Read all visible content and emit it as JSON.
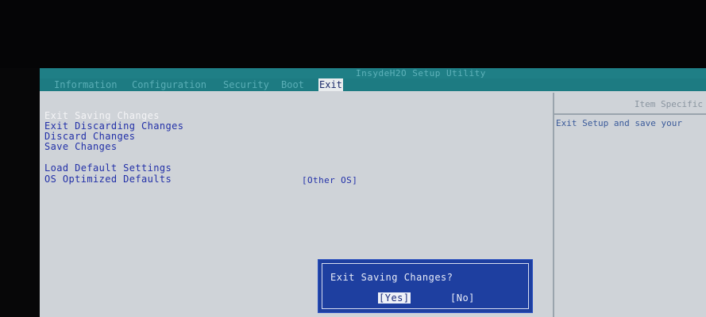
{
  "title": "InsydeH2O Setup Utility",
  "menu": [
    {
      "label": "Information",
      "active": false
    },
    {
      "label": "Configuration",
      "active": false
    },
    {
      "label": "Security",
      "active": false
    },
    {
      "label": "Boot",
      "active": false
    },
    {
      "label": "Exit",
      "active": true
    }
  ],
  "options": [
    {
      "label": "Exit Saving Changes",
      "selected": true
    },
    {
      "label": "Exit Discarding Changes",
      "selected": false
    },
    {
      "label": "Discard Changes",
      "selected": false
    },
    {
      "label": "Save Changes",
      "selected": false
    },
    {
      "label": "Load Default Settings",
      "selected": false
    },
    {
      "label": "OS Optimized Defaults",
      "selected": false,
      "value": "[Other OS]"
    }
  ],
  "help_panel": {
    "header": "Item Specific",
    "text": "Exit Setup and save your"
  },
  "dialog": {
    "message": "Exit Saving Changes?",
    "buttons": [
      {
        "label": "[Yes]",
        "focused": true
      },
      {
        "label": "[No]",
        "focused": false
      }
    ]
  },
  "colors": {
    "accent_menubar": "#1d7b82",
    "option_text": "#2230a8",
    "dialog_bg": "#1e3fa0"
  }
}
